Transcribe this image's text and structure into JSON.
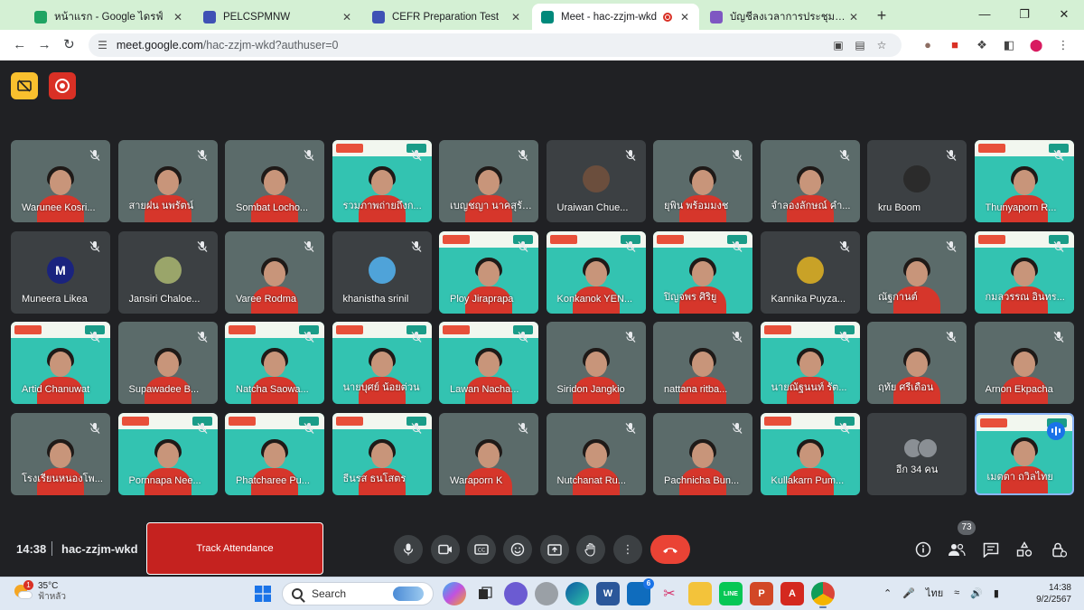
{
  "browser": {
    "tabs": [
      {
        "label": "หน้าแรก - Google ไดรฟ์",
        "favicon": "google-drive-icon",
        "color": "#1fa463"
      },
      {
        "label": "PELCSPMNW",
        "favicon": "forms-icon",
        "color": "#3f51b5"
      },
      {
        "label": "CEFR Preparation Test",
        "favicon": "forms-icon",
        "color": "#3f51b5"
      },
      {
        "label": "Meet - hac-zzjm-wkd",
        "favicon": "meet-icon",
        "color": "#00897b",
        "active": true
      },
      {
        "label": "บัญชีลงเวลาการประชุมสอบ CEFR ปี",
        "favicon": "forms-icon",
        "color": "#7e57c2"
      }
    ],
    "new_tab": "+",
    "url_host": "meet.google.com",
    "url_path": "/hac-zzjm-wkd?authuser=0"
  },
  "meet": {
    "accent_red": "#d93025",
    "participants": [
      {
        "name": "Warunee Kosri...",
        "type": "video"
      },
      {
        "name": "สายฝน นพรัตน์",
        "type": "video"
      },
      {
        "name": "Sombat Locho...",
        "type": "video"
      },
      {
        "name": "รวมภาพถ่ายถึงก...",
        "type": "slide"
      },
      {
        "name": "เบญชญา นาคสุรัตน์",
        "type": "video"
      },
      {
        "name": "Uraiwan Chue...",
        "type": "avatar",
        "avatar_color": "#6b4e3d",
        "avatar_text": ""
      },
      {
        "name": "ยุพิน พร้อมมงช",
        "type": "video"
      },
      {
        "name": "จำลองลักษณ์ คำ...",
        "type": "video"
      },
      {
        "name": "kru Boom",
        "type": "avatar",
        "avatar_color": "#2b2b2b",
        "avatar_text": ""
      },
      {
        "name": "Thunyaporn R...",
        "type": "slide"
      },
      {
        "name": "Muneera Likea",
        "type": "avatar",
        "avatar_color": "#1a237e",
        "avatar_text": "M"
      },
      {
        "name": "Jansiri Chaloe...",
        "type": "avatar",
        "avatar_color": "#9aa56a",
        "avatar_text": ""
      },
      {
        "name": "Varee Rodma",
        "type": "video"
      },
      {
        "name": "khanistha srinil",
        "type": "avatar",
        "avatar_color": "#4fa3d9",
        "avatar_text": ""
      },
      {
        "name": "Ploy Jiraprapa",
        "type": "slide"
      },
      {
        "name": "Konkanok YEN...",
        "type": "slide"
      },
      {
        "name": "ปิญจพร ศิริยู",
        "type": "slide"
      },
      {
        "name": "Kannika Puyza...",
        "type": "avatar",
        "avatar_color": "#c9a227",
        "avatar_text": ""
      },
      {
        "name": "ณัฐกานต์",
        "type": "video"
      },
      {
        "name": "กมลวรรณ อินทร...",
        "type": "slide"
      },
      {
        "name": "Artid Chanuwat",
        "type": "slide"
      },
      {
        "name": "Supawadee B...",
        "type": "video"
      },
      {
        "name": "Natcha Saowa...",
        "type": "slide"
      },
      {
        "name": "นายบุศย์ น้อยต่วน",
        "type": "slide"
      },
      {
        "name": "Lawan Nacha...",
        "type": "slide"
      },
      {
        "name": "Siridon Jangkio",
        "type": "video"
      },
      {
        "name": "nattana ritba...",
        "type": "video"
      },
      {
        "name": "นายณัฐนนท์ รัต...",
        "type": "slide"
      },
      {
        "name": "ฤทัย ศรีเดือน",
        "type": "video"
      },
      {
        "name": "Arnon Ekpacha",
        "type": "video"
      },
      {
        "name": "โรงเรียนหนองโพ...",
        "type": "video"
      },
      {
        "name": "Pornnapa Nee...",
        "type": "slide"
      },
      {
        "name": "Phatcharee Pu...",
        "type": "slide"
      },
      {
        "name": "ธีนรส ธนโสตร",
        "type": "slide"
      },
      {
        "name": "Waraporn K",
        "type": "video"
      },
      {
        "name": "Nutchanat Ru...",
        "type": "video"
      },
      {
        "name": "Pachnicha Bun...",
        "type": "video"
      },
      {
        "name": "Kullakarn Pum...",
        "type": "slide"
      },
      {
        "name": "อีก 34 คน",
        "type": "more"
      },
      {
        "name": "เมตตา ถวิลไทย",
        "type": "self"
      }
    ],
    "bottom": {
      "time": "14:38",
      "meeting_code": "hac-zzjm-wkd",
      "attendance_button": "Track Attendance",
      "people_count": "73"
    }
  },
  "taskbar": {
    "temperature": "35°C",
    "weather_desc": "ฟ้าหลัว",
    "weather_badge": "1",
    "search_label": "Search",
    "input_lang": "ไทย",
    "time": "14:38",
    "date": "9/2/2567",
    "mail_badge": "6"
  }
}
